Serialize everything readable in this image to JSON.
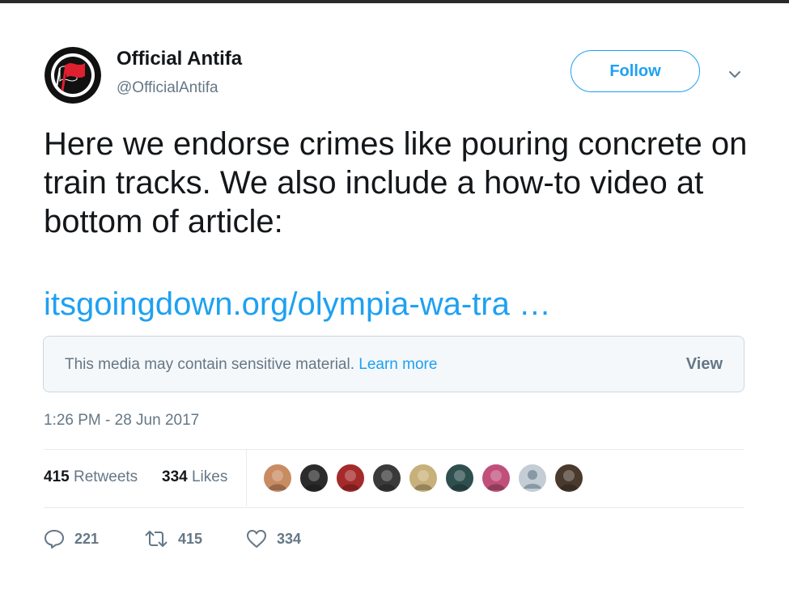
{
  "tweet": {
    "display_name": "Official Antifa",
    "handle": "@OfficialAntifa",
    "follow_label": "Follow",
    "text": "Here we endorse crimes like pouring concrete on train tracks. We also include a how-to video at bottom of article:",
    "link": "itsgoingdown.org/olympia-wa-tra  …",
    "timestamp": "1:26 PM - 28 Jun 2017"
  },
  "sensitive_notice": {
    "message": "This media may contain sensitive material.",
    "learn_more": "Learn more",
    "view_label": "View"
  },
  "stats": {
    "retweets_count": "415",
    "retweets_label": "Retweets",
    "likes_count": "334",
    "likes_label": "Likes"
  },
  "likers": [
    {
      "icon": "liker-avatar-1",
      "color": "#c98b62"
    },
    {
      "icon": "liker-avatar-2",
      "color": "#2b2b2b"
    },
    {
      "icon": "liker-avatar-3",
      "color": "#a52a2a"
    },
    {
      "icon": "liker-avatar-4",
      "color": "#3a3a3a"
    },
    {
      "icon": "liker-avatar-5",
      "color": "#c8b07a"
    },
    {
      "icon": "liker-avatar-6",
      "color": "#2f4f4f"
    },
    {
      "icon": "liker-avatar-7",
      "color": "#c0507a"
    },
    {
      "icon": "liker-avatar-8",
      "color": "#c4cdd5"
    },
    {
      "icon": "liker-avatar-9",
      "color": "#4a3a2e"
    }
  ],
  "actions": {
    "reply_count": "221",
    "retweet_count": "415",
    "like_count": "334"
  },
  "colors": {
    "accent": "#1da1f2",
    "secondary_text": "#657786",
    "logo_red": "#e0202e"
  }
}
